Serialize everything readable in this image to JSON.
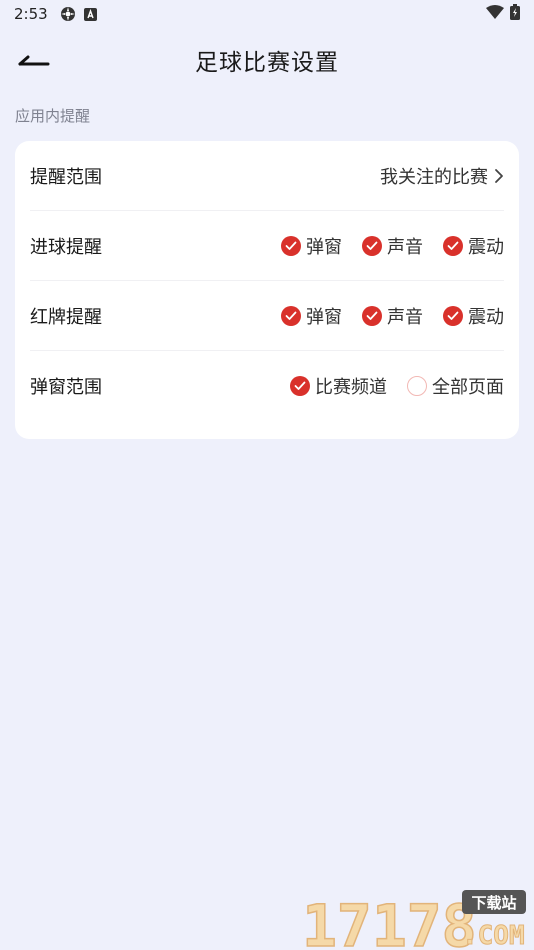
{
  "status": {
    "time": "2:53"
  },
  "header": {
    "title": "足球比赛设置"
  },
  "section": {
    "label": "应用内提醒"
  },
  "rows": {
    "scope": {
      "label": "提醒范围",
      "value": "我关注的比赛"
    },
    "goal": {
      "label": "进球提醒",
      "options": [
        "弹窗",
        "声音",
        "震动"
      ],
      "checked": [
        true,
        true,
        true
      ]
    },
    "redcard": {
      "label": "红牌提醒",
      "options": [
        "弹窗",
        "声音",
        "震动"
      ],
      "checked": [
        true,
        true,
        true
      ]
    },
    "popup": {
      "label": "弹窗范围",
      "options": [
        "比赛频道",
        "全部页面"
      ],
      "checked": [
        true,
        false
      ]
    }
  },
  "watermark": {
    "text": "17178",
    "badge": "下载站",
    "suffix": ".COM"
  },
  "colors": {
    "accent": "#d9312b",
    "background": "#eef0fb",
    "card": "#ffffff"
  }
}
